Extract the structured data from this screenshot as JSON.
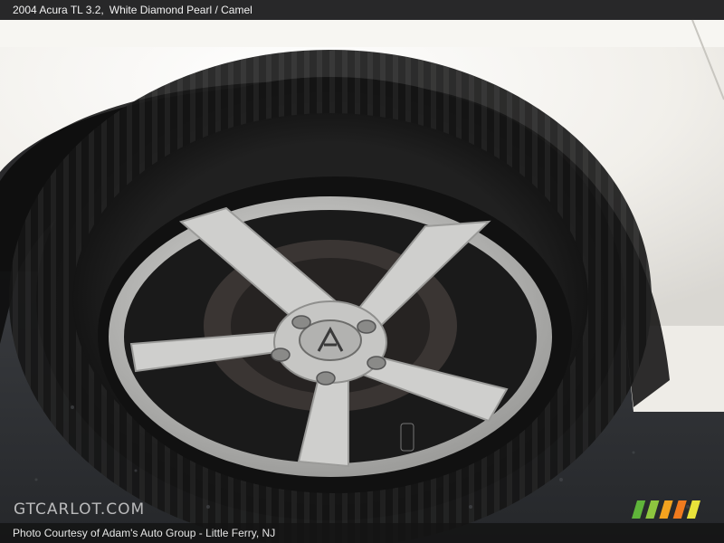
{
  "header": {
    "vehicle": "2004 Acura TL 3.2,",
    "color": "White Diamond Pearl / Camel"
  },
  "watermark": {
    "text": "GTCARLOT.COM"
  },
  "footer": {
    "credit": "Photo Courtesy of Adam's Auto Group - Little Ferry, NJ"
  },
  "colors": {
    "body_paint": "#f1efea",
    "tire": "#141414",
    "wheel": "#c9c9c7",
    "pavement": "#2b2d30",
    "stripes": [
      "#5fb43a",
      "#8ec63f",
      "#f3a21f",
      "#f07a1e",
      "#e8e23a"
    ]
  },
  "icons": {
    "emblem": "acura-logo",
    "brand_mark": "gtcarlot-stripes-logo"
  }
}
